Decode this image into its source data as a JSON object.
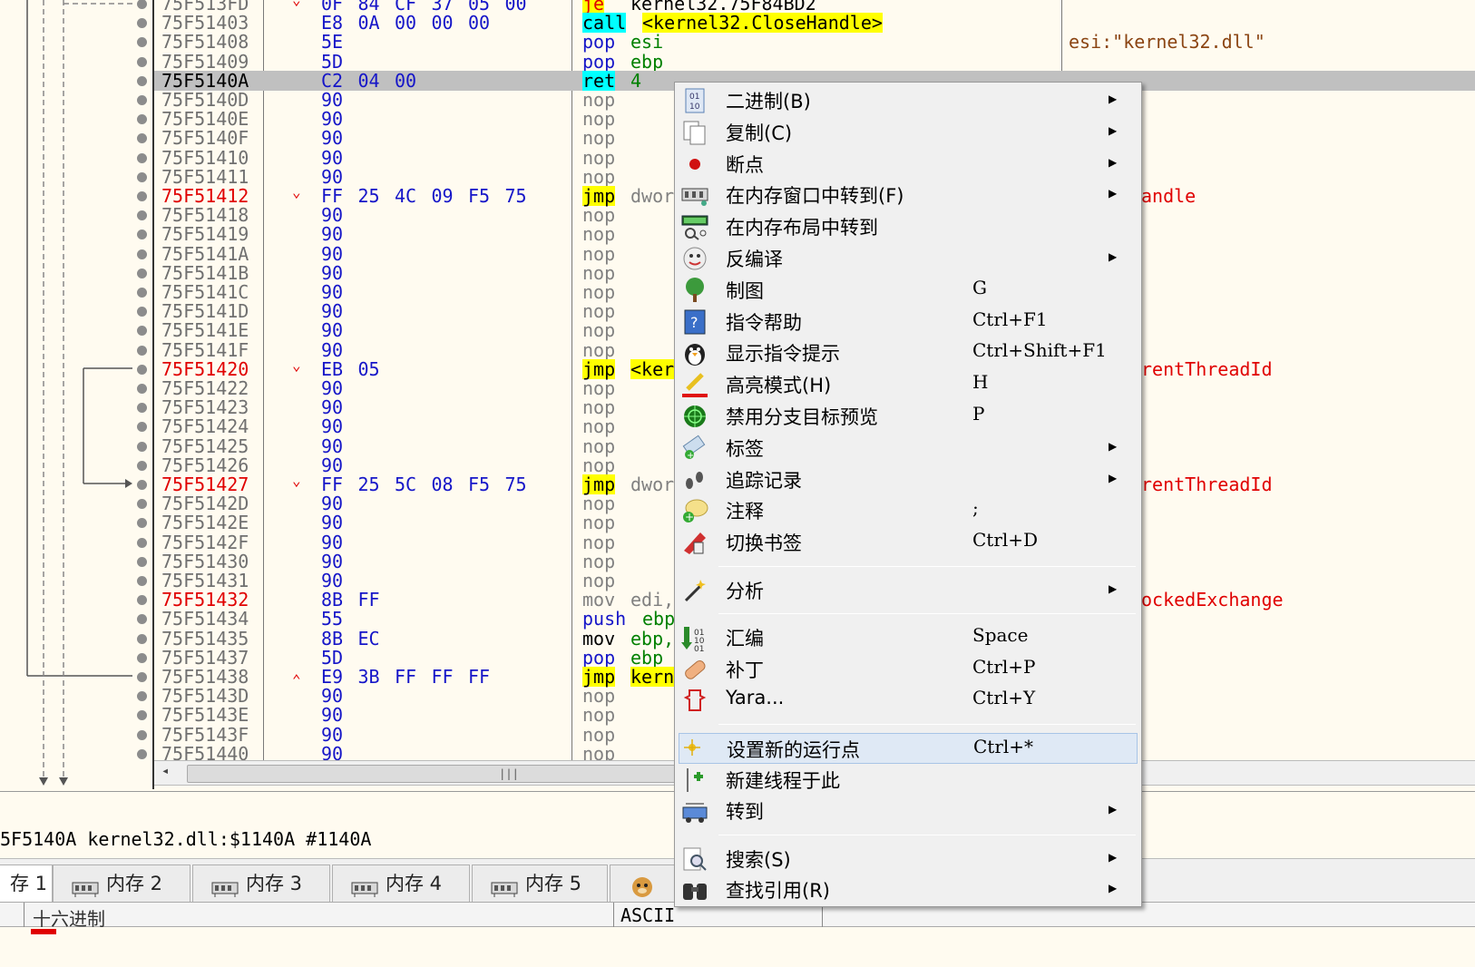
{
  "rows": [
    {
      "addr": "75F513FD",
      "addr_color": "",
      "arrow": "v",
      "bytes": [
        [
          "0F",
          "k"
        ],
        [
          "84",
          "k"
        ],
        [
          "CF",
          "p"
        ],
        [
          "37",
          "p"
        ],
        [
          "05",
          "g"
        ],
        [
          "00",
          "g"
        ]
      ],
      "mn": "je",
      "mn_hl": "y",
      "mn_color": "r",
      "op": "kernel32.75F84BD2",
      "op_hl": "",
      "cmt": "",
      "partial": true
    },
    {
      "addr": "75F51403",
      "addr_color": "",
      "arrow": "",
      "bytes": [
        [
          "E8",
          "k"
        ],
        [
          "0A",
          "r"
        ],
        [
          "00",
          "g"
        ],
        [
          "00",
          "g"
        ],
        [
          "00",
          "g"
        ]
      ],
      "mn": "call",
      "mn_hl": "c",
      "mn_color": "k",
      "op": "<kernel32.CloseHandle>",
      "op_hl": "y",
      "cmt": ""
    },
    {
      "addr": "75F51408",
      "addr_color": "",
      "arrow": "",
      "bytes": [
        [
          "5E",
          "p"
        ]
      ],
      "mn": "pop",
      "mn_hl": "",
      "mn_color": "b",
      "op": "esi",
      "op_hl": "",
      "op_color": "g",
      "cmt": "esi:\"kernel32.dll\"",
      "cmt_color": "dark"
    },
    {
      "addr": "75F51409",
      "addr_color": "",
      "arrow": "",
      "bytes": [
        [
          "5D",
          "p"
        ]
      ],
      "mn": "pop",
      "mn_hl": "",
      "mn_color": "b",
      "op": "ebp",
      "op_hl": "",
      "op_color": "g",
      "cmt": ""
    },
    {
      "addr": "75F5140A",
      "addr_color": "black",
      "arrow": "",
      "bytes": [
        [
          "C2",
          "k"
        ],
        [
          "04",
          "k"
        ],
        [
          "00",
          "g"
        ]
      ],
      "mn": "ret",
      "mn_hl": "c",
      "mn_color": "k",
      "op": "4",
      "op_hl": "",
      "op_color": "g",
      "cmt": "",
      "selected": true
    },
    {
      "addr": "75F5140D",
      "addr_color": "",
      "arrow": "",
      "bytes": [
        [
          "90",
          "k"
        ]
      ],
      "mn": "nop",
      "mn_hl": "",
      "mn_color": "n",
      "op": "",
      "cmt": ""
    },
    {
      "addr": "75F5140E",
      "addr_color": "",
      "arrow": "",
      "bytes": [
        [
          "90",
          "k"
        ]
      ],
      "mn": "nop",
      "mn_hl": "",
      "mn_color": "n",
      "op": "",
      "cmt": ""
    },
    {
      "addr": "75F5140F",
      "addr_color": "",
      "arrow": "",
      "bytes": [
        [
          "90",
          "k"
        ]
      ],
      "mn": "nop",
      "mn_hl": "",
      "mn_color": "n",
      "op": "",
      "cmt": ""
    },
    {
      "addr": "75F51410",
      "addr_color": "",
      "arrow": "",
      "bytes": [
        [
          "90",
          "k"
        ]
      ],
      "mn": "nop",
      "mn_hl": "",
      "mn_color": "n",
      "op": "",
      "cmt": ""
    },
    {
      "addr": "75F51411",
      "addr_color": "",
      "arrow": "",
      "bytes": [
        [
          "90",
          "k"
        ]
      ],
      "mn": "nop",
      "mn_hl": "",
      "mn_color": "n",
      "op": "",
      "cmt": ""
    },
    {
      "addr": "75F51412",
      "addr_color": "red",
      "arrow": "v",
      "bytes": [
        [
          "FF",
          "r"
        ],
        [
          "25",
          "p"
        ],
        [
          "4C",
          "p"
        ],
        [
          "09",
          "p"
        ],
        [
          "F5",
          "k"
        ],
        [
          "75",
          "p"
        ]
      ],
      "mn": "jmp",
      "mn_hl": "y",
      "mn_color": "k",
      "op": "dwor",
      "op_hl": "",
      "op_color": "n",
      "cmt": "andle"
    },
    {
      "addr": "75F51418",
      "addr_color": "",
      "arrow": "",
      "bytes": [
        [
          "90",
          "k"
        ]
      ],
      "mn": "nop",
      "mn_hl": "",
      "mn_color": "n",
      "op": "",
      "cmt": ""
    },
    {
      "addr": "75F51419",
      "addr_color": "",
      "arrow": "",
      "bytes": [
        [
          "90",
          "k"
        ]
      ],
      "mn": "nop",
      "mn_hl": "",
      "mn_color": "n",
      "op": "",
      "cmt": ""
    },
    {
      "addr": "75F5141A",
      "addr_color": "",
      "arrow": "",
      "bytes": [
        [
          "90",
          "k"
        ]
      ],
      "mn": "nop",
      "mn_hl": "",
      "mn_color": "n",
      "op": "",
      "cmt": ""
    },
    {
      "addr": "75F5141B",
      "addr_color": "",
      "arrow": "",
      "bytes": [
        [
          "90",
          "k"
        ]
      ],
      "mn": "nop",
      "mn_hl": "",
      "mn_color": "n",
      "op": "",
      "cmt": ""
    },
    {
      "addr": "75F5141C",
      "addr_color": "",
      "arrow": "",
      "bytes": [
        [
          "90",
          "k"
        ]
      ],
      "mn": "nop",
      "mn_hl": "",
      "mn_color": "n",
      "op": "",
      "cmt": ""
    },
    {
      "addr": "75F5141D",
      "addr_color": "",
      "arrow": "",
      "bytes": [
        [
          "90",
          "k"
        ]
      ],
      "mn": "nop",
      "mn_hl": "",
      "mn_color": "n",
      "op": "",
      "cmt": ""
    },
    {
      "addr": "75F5141E",
      "addr_color": "",
      "arrow": "",
      "bytes": [
        [
          "90",
          "k"
        ]
      ],
      "mn": "nop",
      "mn_hl": "",
      "mn_color": "n",
      "op": "",
      "cmt": ""
    },
    {
      "addr": "75F5141F",
      "addr_color": "",
      "arrow": "",
      "bytes": [
        [
          "90",
          "k"
        ]
      ],
      "mn": "nop",
      "mn_hl": "",
      "mn_color": "n",
      "op": "",
      "cmt": ""
    },
    {
      "addr": "75F51420",
      "addr_color": "red",
      "arrow": "v",
      "bytes": [
        [
          "EB",
          "r"
        ],
        [
          "05",
          "k"
        ]
      ],
      "mn": "jmp",
      "mn_hl": "y",
      "mn_color": "k",
      "op": "<ker",
      "op_hl": "y",
      "op_color": "k",
      "cmt": "rentThreadId"
    },
    {
      "addr": "75F51422",
      "addr_color": "",
      "arrow": "",
      "bytes": [
        [
          "90",
          "k"
        ]
      ],
      "mn": "nop",
      "mn_hl": "",
      "mn_color": "n",
      "op": "",
      "cmt": ""
    },
    {
      "addr": "75F51423",
      "addr_color": "",
      "arrow": "",
      "bytes": [
        [
          "90",
          "k"
        ]
      ],
      "mn": "nop",
      "mn_hl": "",
      "mn_color": "n",
      "op": "",
      "cmt": ""
    },
    {
      "addr": "75F51424",
      "addr_color": "",
      "arrow": "",
      "bytes": [
        [
          "90",
          "k"
        ]
      ],
      "mn": "nop",
      "mn_hl": "",
      "mn_color": "n",
      "op": "",
      "cmt": ""
    },
    {
      "addr": "75F51425",
      "addr_color": "",
      "arrow": "",
      "bytes": [
        [
          "90",
          "k"
        ]
      ],
      "mn": "nop",
      "mn_hl": "",
      "mn_color": "n",
      "op": "",
      "cmt": ""
    },
    {
      "addr": "75F51426",
      "addr_color": "",
      "arrow": "",
      "bytes": [
        [
          "90",
          "k"
        ]
      ],
      "mn": "nop",
      "mn_hl": "",
      "mn_color": "n",
      "op": "",
      "cmt": ""
    },
    {
      "addr": "75F51427",
      "addr_color": "red",
      "arrow": "v",
      "bytes": [
        [
          "FF",
          "r"
        ],
        [
          "25",
          "p"
        ],
        [
          "5C",
          "p"
        ],
        [
          "08",
          "k"
        ],
        [
          "F5",
          "k"
        ],
        [
          "75",
          "p"
        ]
      ],
      "mn": "jmp",
      "mn_hl": "y",
      "mn_color": "k",
      "op": "dwor",
      "op_hl": "",
      "op_color": "n",
      "cmt": "rentThreadId"
    },
    {
      "addr": "75F5142D",
      "addr_color": "",
      "arrow": "",
      "bytes": [
        [
          "90",
          "k"
        ]
      ],
      "mn": "nop",
      "mn_hl": "",
      "mn_color": "n",
      "op": "",
      "cmt": ""
    },
    {
      "addr": "75F5142E",
      "addr_color": "",
      "arrow": "",
      "bytes": [
        [
          "90",
          "k"
        ]
      ],
      "mn": "nop",
      "mn_hl": "",
      "mn_color": "n",
      "op": "",
      "cmt": ""
    },
    {
      "addr": "75F5142F",
      "addr_color": "",
      "arrow": "",
      "bytes": [
        [
          "90",
          "k"
        ]
      ],
      "mn": "nop",
      "mn_hl": "",
      "mn_color": "n",
      "op": "",
      "cmt": ""
    },
    {
      "addr": "75F51430",
      "addr_color": "",
      "arrow": "",
      "bytes": [
        [
          "90",
          "k"
        ]
      ],
      "mn": "nop",
      "mn_hl": "",
      "mn_color": "n",
      "op": "",
      "cmt": ""
    },
    {
      "addr": "75F51431",
      "addr_color": "",
      "arrow": "",
      "bytes": [
        [
          "90",
          "k"
        ]
      ],
      "mn": "nop",
      "mn_hl": "",
      "mn_color": "n",
      "op": "",
      "cmt": ""
    },
    {
      "addr": "75F51432",
      "addr_color": "red",
      "arrow": "",
      "bytes": [
        [
          "8B",
          "k"
        ],
        [
          "FF",
          "r"
        ]
      ],
      "mn": "mov",
      "mn_hl": "",
      "mn_color": "n",
      "op": "edi,",
      "op_hl": "",
      "op_color": "n",
      "cmt": "ockedExchange"
    },
    {
      "addr": "75F51434",
      "addr_color": "",
      "arrow": "",
      "bytes": [
        [
          "55",
          "p"
        ]
      ],
      "mn": "push",
      "mn_hl": "",
      "mn_color": "b",
      "op": "ebp",
      "op_hl": "",
      "op_color": "g",
      "cmt": ""
    },
    {
      "addr": "75F51435",
      "addr_color": "",
      "arrow": "",
      "bytes": [
        [
          "8B",
          "k"
        ],
        [
          "EC",
          "k"
        ]
      ],
      "mn": "mov",
      "mn_hl": "",
      "mn_color": "k",
      "op": "ebp,",
      "op_hl": "",
      "op_color": "g",
      "cmt": ""
    },
    {
      "addr": "75F51437",
      "addr_color": "",
      "arrow": "",
      "bytes": [
        [
          "5D",
          "p"
        ]
      ],
      "mn": "pop",
      "mn_hl": "",
      "mn_color": "b",
      "op": "ebp",
      "op_hl": "",
      "op_color": "g",
      "cmt": ""
    },
    {
      "addr": "75F51438",
      "addr_color": "",
      "arrow": "^",
      "bytes": [
        [
          "E9",
          "r"
        ],
        [
          "3B",
          "p"
        ],
        [
          "FF",
          "r"
        ],
        [
          "FF",
          "r"
        ],
        [
          "FF",
          "r"
        ]
      ],
      "mn": "jmp",
      "mn_hl": "y",
      "mn_color": "k",
      "op": "kern",
      "op_hl": "y",
      "op_color": "k",
      "cmt": ""
    },
    {
      "addr": "75F5143D",
      "addr_color": "",
      "arrow": "",
      "bytes": [
        [
          "90",
          "k"
        ]
      ],
      "mn": "nop",
      "mn_hl": "",
      "mn_color": "n",
      "op": "",
      "cmt": ""
    },
    {
      "addr": "75F5143E",
      "addr_color": "",
      "arrow": "",
      "bytes": [
        [
          "90",
          "k"
        ]
      ],
      "mn": "nop",
      "mn_hl": "",
      "mn_color": "n",
      "op": "",
      "cmt": ""
    },
    {
      "addr": "75F5143F",
      "addr_color": "",
      "arrow": "",
      "bytes": [
        [
          "90",
          "k"
        ]
      ],
      "mn": "nop",
      "mn_hl": "",
      "mn_color": "n",
      "op": "",
      "cmt": ""
    },
    {
      "addr": "75F51440",
      "addr_color": "",
      "arrow": "",
      "bytes": [
        [
          "90",
          "k"
        ]
      ],
      "mn": "nop",
      "mn_hl": "",
      "mn_color": "n",
      "op": "",
      "cmt": ""
    }
  ],
  "scrollbar": {
    "thumb_glyph": "|||"
  },
  "infobar": {
    "text": "5F5140A kernel32.dll:$1140A #1140A"
  },
  "tabs": [
    {
      "label": "存 1",
      "icon": "memory-icon"
    },
    {
      "label": "内存 2",
      "icon": "memory-icon"
    },
    {
      "label": "内存 3",
      "icon": "memory-icon"
    },
    {
      "label": "内存 4",
      "icon": "memory-icon"
    },
    {
      "label": "内存 5",
      "icon": "memory-icon"
    },
    {
      "label": "",
      "icon": "watch-icon"
    }
  ],
  "hexpanel": {
    "col1": "十六进制",
    "col2": "ASCII"
  },
  "menu": [
    {
      "label": "二进制(B)",
      "shortcut": "",
      "submenu": true,
      "icon": "binary-icon"
    },
    {
      "label": "复制(C)",
      "shortcut": "",
      "submenu": true,
      "icon": "copy-icon"
    },
    {
      "label": "断点",
      "shortcut": "",
      "submenu": true,
      "icon": "breakpoint-icon"
    },
    {
      "label": "在内存窗口中转到(F)",
      "shortcut": "",
      "submenu": true,
      "icon": "memory-window-icon"
    },
    {
      "label": "在内存布局中转到",
      "shortcut": "",
      "submenu": false,
      "icon": "memory-map-icon"
    },
    {
      "label": "反编译",
      "shortcut": "",
      "submenu": true,
      "icon": "decompile-icon"
    },
    {
      "label": "制图",
      "shortcut": "G",
      "submenu": false,
      "icon": "graph-icon"
    },
    {
      "label": "指令帮助",
      "shortcut": "Ctrl+F1",
      "submenu": false,
      "icon": "help-icon"
    },
    {
      "label": "显示指令提示",
      "shortcut": "Ctrl+Shift+F1",
      "submenu": false,
      "icon": "hint-icon"
    },
    {
      "label": "高亮模式(H)",
      "shortcut": "H",
      "submenu": false,
      "icon": "highlight-icon"
    },
    {
      "label": "禁用分支目标预览",
      "shortcut": "P",
      "submenu": false,
      "icon": "preview-icon"
    },
    {
      "label": "标签",
      "shortcut": "",
      "submenu": true,
      "icon": "label-icon"
    },
    {
      "label": "追踪记录",
      "shortcut": "",
      "submenu": true,
      "icon": "trace-icon"
    },
    {
      "label": "注释",
      "shortcut": ";",
      "submenu": false,
      "icon": "comment-icon"
    },
    {
      "label": "切换书签",
      "shortcut": "Ctrl+D",
      "submenu": false,
      "icon": "bookmark-icon"
    },
    {
      "sep": true
    },
    {
      "label": "分析",
      "shortcut": "",
      "submenu": true,
      "icon": "analyze-icon"
    },
    {
      "sep": true
    },
    {
      "label": "汇编",
      "shortcut": "Space",
      "submenu": false,
      "icon": "assemble-icon"
    },
    {
      "label": "补丁",
      "shortcut": "Ctrl+P",
      "submenu": false,
      "icon": "patch-icon"
    },
    {
      "label": "Yara...",
      "shortcut": "Ctrl+Y",
      "submenu": false,
      "icon": "yara-icon"
    },
    {
      "sep": true
    },
    {
      "label": "设置新的运行点",
      "shortcut": "Ctrl+*",
      "submenu": false,
      "icon": "set-origin-icon",
      "hover": true
    },
    {
      "label": "新建线程于此",
      "shortcut": "",
      "submenu": false,
      "icon": "new-thread-icon"
    },
    {
      "label": "转到",
      "shortcut": "",
      "submenu": true,
      "icon": "goto-icon"
    },
    {
      "sep": true
    },
    {
      "label": "搜索(S)",
      "shortcut": "",
      "submenu": true,
      "icon": "search-icon"
    },
    {
      "label": "查找引用(R)",
      "shortcut": "",
      "submenu": true,
      "icon": "find-references-icon"
    }
  ],
  "colors": {
    "highlight_yellow": "#ffff00",
    "highlight_cyan": "#00ffff",
    "address_red": "#e00000",
    "selection": "#c0c0c0",
    "background": "#fffbf0"
  }
}
